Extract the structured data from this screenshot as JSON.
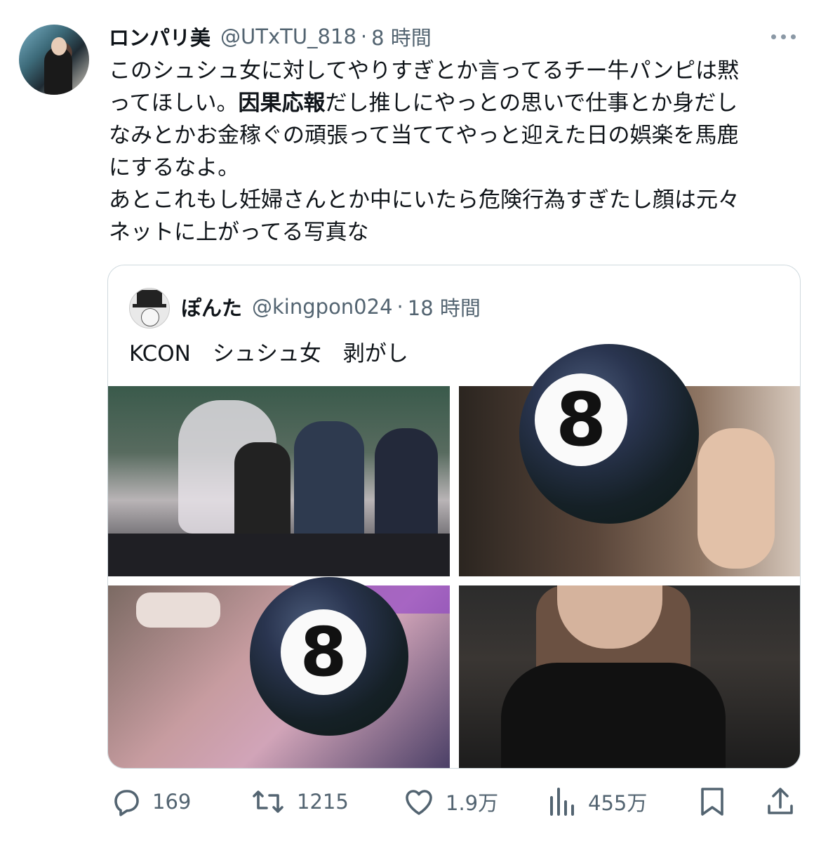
{
  "tweet": {
    "author_name": "ロンパリ美",
    "author_handle": "@UTxTU_818",
    "separator": "·",
    "time": "8 時間",
    "text_line1": "このシュシュ女に対してやりすぎとか言ってるチー牛パンピは黙",
    "text_line2_a": "ってほしい。",
    "text_line2_bold": "因果応報",
    "text_line2_b": "だし推しにやっとの思いで仕事とか身だし",
    "text_line3": "なみとかお金稼ぐの頑張って当ててやっと迎えた日の娯楽を馬鹿",
    "text_line4": "にするなよ。",
    "text_line5": "あとこれもし妊婦さんとか中にいたら危険行為すぎたし顔は元々",
    "text_line6": "ネットに上がってる写真な"
  },
  "quoted": {
    "author_name": "ぽんた",
    "author_handle": "@kingpon024",
    "separator": "·",
    "time": "18 時間",
    "text": "KCON　シュシュ女　剥がし"
  },
  "media": {
    "ball_label": "8"
  },
  "actions": {
    "replies": "169",
    "retweets": "1215",
    "likes": "1.9万",
    "views": "455万"
  },
  "icons": {
    "more": "more-icon",
    "reply": "reply-icon",
    "retweet": "retweet-icon",
    "like": "heart-icon",
    "views": "views-icon",
    "bookmark": "bookmark-icon",
    "share": "share-icon"
  },
  "colors": {
    "text_primary": "#0f1419",
    "text_secondary": "#536471",
    "border": "#cfd9de"
  }
}
